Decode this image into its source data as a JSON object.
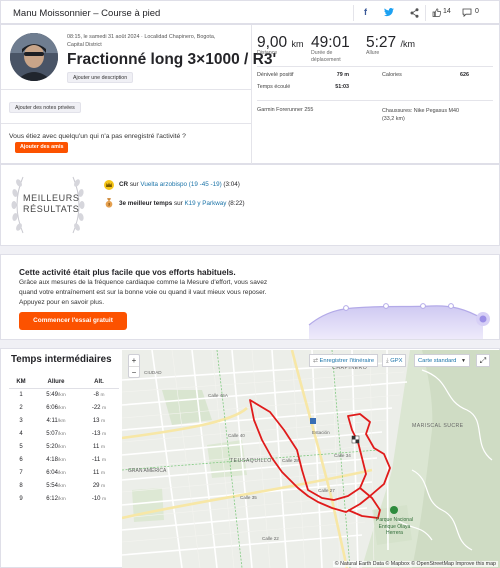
{
  "header": {
    "title": "Manu Moissonnier – Course à pied",
    "kudos_count": "14",
    "comments_count": "0"
  },
  "activity": {
    "meta_line1": "08:15, le samedi 31 août 2024 · Localidad Chapinero, Bogota,",
    "meta_line2": "Capital District",
    "add_description": "Ajouter une description",
    "title": "Fractionné long 3×1000 / R3'",
    "add_private_notes": "Ajouter des notes privées",
    "invite_text": "Vous étiez avec quelqu'un qui n'a pas enregistré l'activité ?",
    "add_friends": "Ajouter des amis"
  },
  "stats": {
    "distance_value": "9,00",
    "distance_unit": "km",
    "distance_label": "Distance",
    "moving_time_value": "49:01",
    "moving_time_label_1": "Durée de",
    "moving_time_label_2": "déplacement",
    "pace_value": "5:27",
    "pace_unit": "/km",
    "pace_label": "Allure",
    "elevation_label": "Dénivelé positif",
    "elevation_value": "79 m",
    "calories_label": "Calories",
    "calories_value": "626",
    "elapsed_label": "Temps écoulé",
    "elapsed_value": "51:03",
    "device": "Garmin Forerunner 255",
    "shoes_line1": "Chaussures: Nike Pegasus M40",
    "shoes_line2": "(33,2 km)"
  },
  "best": {
    "badge_line1": "MEILLEURS",
    "badge_line2": "RÉSULTATS",
    "rows": [
      {
        "prefix": "CR",
        "mid": " sur ",
        "segment": "Vuelta arzobispo (19 -45 -19)",
        "time": " (3:04)"
      },
      {
        "prefix": "3e meilleur temps",
        "mid": " sur ",
        "segment": "K19 y Parkway",
        "time": " (8:22)"
      }
    ]
  },
  "upsell": {
    "title": "Cette activité était plus facile que vos efforts habituels.",
    "body": "Grâce aux mesures de la fréquence cardiaque comme la Mesure d'effort, vous savez quand votre entraînement est sur la bonne voie ou quand il vaut mieux vous reposer. Appuyez pour en savoir plus.",
    "cta": "Commencer l'essai gratuit"
  },
  "splits": {
    "title": "Temps intermédiaires",
    "headers": {
      "km": "KM",
      "pace": "Allure",
      "alt": "Alt."
    },
    "pace_unit": "/km",
    "alt_unit": "m",
    "rows": [
      {
        "km": "1",
        "pace": "5:49",
        "alt": "-8"
      },
      {
        "km": "2",
        "pace": "6:06",
        "alt": "-22"
      },
      {
        "km": "3",
        "pace": "4:11",
        "alt": "13"
      },
      {
        "km": "4",
        "pace": "5:07",
        "alt": "-13"
      },
      {
        "km": "5",
        "pace": "5:20",
        "alt": "11"
      },
      {
        "km": "6",
        "pace": "4:18",
        "alt": "-11"
      },
      {
        "km": "7",
        "pace": "6:04",
        "alt": "11"
      },
      {
        "km": "8",
        "pace": "5:54",
        "alt": "29"
      },
      {
        "km": "9",
        "pace": "6:12",
        "alt": "-10"
      }
    ]
  },
  "map": {
    "zoom_in": "+",
    "zoom_out": "−",
    "save_route": "Enregistrer l'itinéraire",
    "gpx": "GPX",
    "map_style": "Carte standard",
    "labels": {
      "ciudad_bolivariana": "CIUDAD",
      "chapinero": "CHAPINERO",
      "mariscal_sucre": "MARISCAL SUCRE",
      "teusaquillo": "TEUSAQUILLO",
      "gran_america": "GRAN AMÉRICA",
      "park_line1": "Parque Nacional",
      "park_line2": "Enrique Olaya",
      "park_line3": "Herrera",
      "calle_45a": "Calle 45A",
      "calle_40": "Calle 40",
      "calle_34": "Calle 34",
      "calle_35": "Calle 35",
      "calle_28": "Calle 28",
      "calle_27": "Calle 27",
      "calle_22": "Calle 22",
      "station": "Estación"
    },
    "attribution": "© Natural Earth Data © Mapbox © OpenStreetMap  Improve this map"
  },
  "colors": {
    "brand": "#fc5200",
    "link": "#1a73a8",
    "route": "#e01b1b",
    "effort_chart": "#cfc9f2"
  }
}
